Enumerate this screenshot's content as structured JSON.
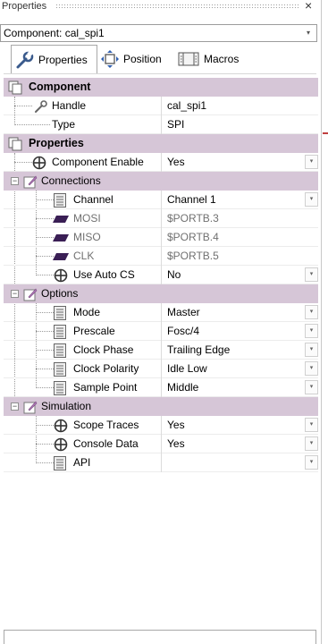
{
  "panel": {
    "title": "Properties",
    "close_glyph": "×"
  },
  "component_selector": {
    "value": "Component: cal_spi1",
    "arrow": "▾"
  },
  "tabs": [
    {
      "label": "Properties",
      "icon": "wrench-icon",
      "active": true
    },
    {
      "label": "Position",
      "icon": "move-icon",
      "active": false
    },
    {
      "label": "Macros",
      "icon": "macros-icon",
      "active": false
    }
  ],
  "grid": {
    "component_category": {
      "label": "Component"
    },
    "handle": {
      "name": "Handle",
      "value": "cal_spi1"
    },
    "type": {
      "name": "Type",
      "value": "SPI"
    },
    "properties_category": {
      "label": "Properties"
    },
    "component_enable": {
      "name": "Component Enable",
      "value": "Yes"
    },
    "connections": {
      "label": "Connections",
      "expander": "−"
    },
    "channel": {
      "name": "Channel",
      "value": "Channel 1"
    },
    "mosi": {
      "name": "MOSI",
      "value": "$PORTB.3"
    },
    "miso": {
      "name": "MISO",
      "value": "$PORTB.4"
    },
    "clk": {
      "name": "CLK",
      "value": "$PORTB.5"
    },
    "use_auto_cs": {
      "name": "Use Auto CS",
      "value": "No"
    },
    "options": {
      "label": "Options",
      "expander": "−"
    },
    "mode": {
      "name": "Mode",
      "value": "Master"
    },
    "prescale": {
      "name": "Prescale",
      "value": "Fosc/4"
    },
    "clock_phase": {
      "name": "Clock Phase",
      "value": "Trailing Edge"
    },
    "clock_polarity": {
      "name": "Clock Polarity",
      "value": "Idle Low"
    },
    "sample_point": {
      "name": "Sample Point",
      "value": "Middle"
    },
    "simulation": {
      "label": "Simulation",
      "expander": "−"
    },
    "scope_traces": {
      "name": "Scope Traces",
      "value": "Yes"
    },
    "console_data": {
      "name": "Console Data",
      "value": "Yes"
    },
    "api": {
      "name": "API",
      "value": ""
    }
  },
  "dropdown_glyph": "▾",
  "colors": {
    "category_bg": "#d6c6d7",
    "border": "#a8a8a8",
    "dim_text": "#707070"
  }
}
